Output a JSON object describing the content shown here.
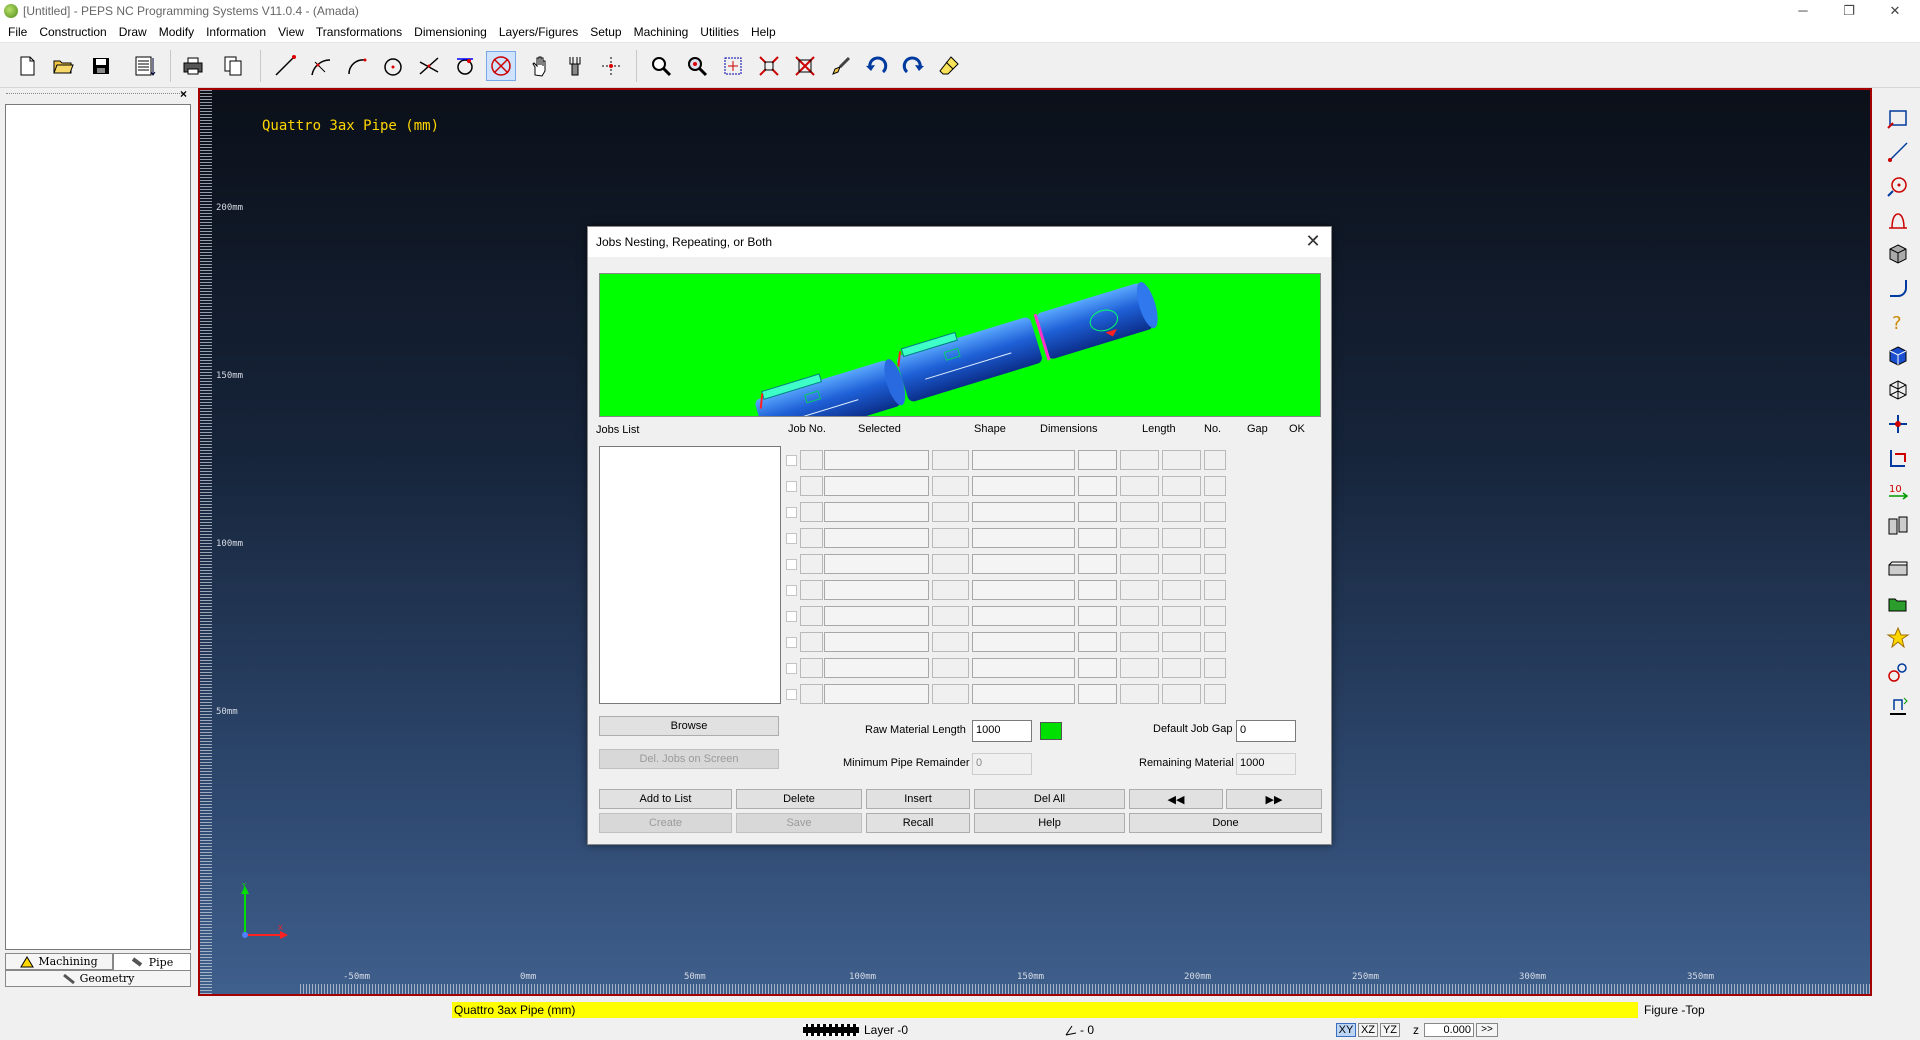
{
  "window": {
    "title": "[Untitled] - PEPS NC Programming Systems V11.0.4 - (Amada)",
    "min": "─",
    "restore": "❐",
    "close": "✕"
  },
  "menu": [
    "File",
    "Construction",
    "Draw",
    "Modify",
    "Information",
    "View",
    "Transformations",
    "Dimensioning",
    "Layers/Figures",
    "Setup",
    "Machining",
    "Utilities",
    "Help"
  ],
  "toolbar_icons": [
    "new-file-icon",
    "open-folder-icon",
    "save-icon",
    "open-series-icon",
    "print-icon",
    "copy-icon",
    "line-icon",
    "arc-3pt-icon",
    "arc-icon",
    "circle-icon",
    "intersection-icon",
    "tangent-icon",
    "cancel-active-icon",
    "hand-pan-icon",
    "tool-icon",
    "grid-points-icon",
    "zoom-icon",
    "zoom-window-icon",
    "redraw-icon",
    "zoom-extents-icon",
    "zoom-all-icon",
    "brush-icon",
    "undo-icon",
    "redo-icon",
    "eraser-icon"
  ],
  "left_panel": {
    "close": "×",
    "tabs": {
      "machining": "Machining",
      "pipe": "Pipe",
      "geometry": "Geometry"
    }
  },
  "canvas": {
    "title": "Quattro 3ax Pipe (mm)",
    "y_ticks": [
      "200mm",
      "150mm",
      "100mm",
      "50mm"
    ],
    "x_ticks": [
      "-50mm",
      "0mm",
      "50mm",
      "100mm",
      "150mm",
      "200mm",
      "250mm",
      "300mm",
      "350mm"
    ],
    "axis_x": "X",
    "axis_y": "Y"
  },
  "right_toolbar_icons": [
    "select-window-icon",
    "measure-icon",
    "circle-point-icon",
    "profile-icon",
    "cube-icon",
    "bend-icon",
    "question-icon",
    "solid-cube-icon",
    "wire-cube-icon",
    "transform-icon",
    "sequence-icon",
    "numbering-icon",
    "tool-change-icon",
    "sheet-icon",
    "folder-icon",
    "star-icon",
    "nodes-icon",
    "export-icon"
  ],
  "dialog": {
    "title": "Jobs Nesting, Repeating, or Both",
    "close": "✕",
    "headers": {
      "jobs_list": "Jobs List",
      "job_no": "Job No.",
      "selected": "Selected",
      "shape": "Shape",
      "dimensions": "Dimensions",
      "length": "Length",
      "no": "No.",
      "gap": "Gap",
      "ok": "OK"
    },
    "buttons": {
      "browse": "Browse",
      "del_jobs": "Del. Jobs on Screen",
      "add": "Add to List",
      "delete": "Delete",
      "insert": "Insert",
      "del_all": "Del All",
      "prev": "◀◀",
      "next": "▶▶",
      "create": "Create",
      "save": "Save",
      "recall": "Recall",
      "help": "Help",
      "done": "Done"
    },
    "labels": {
      "raw_len": "Raw Material Length",
      "min_rem": "Minimum Pipe Remainder",
      "def_gap": "Default Job Gap",
      "rem_mat": "Remaining Material"
    },
    "values": {
      "raw_len": "1000",
      "min_rem": "0",
      "def_gap": "0",
      "rem_mat": "1000"
    },
    "row_count": 10,
    "swatch_color": "#00e000"
  },
  "status": {
    "figure_name": "Quattro 3ax Pipe (mm)",
    "view": "Figure -Top",
    "layer": "Layer -0",
    "points": "- 0",
    "planes": [
      "XY",
      "XZ",
      "YZ"
    ],
    "z_label": "z",
    "z_value": "0.000",
    "go": ">>"
  }
}
